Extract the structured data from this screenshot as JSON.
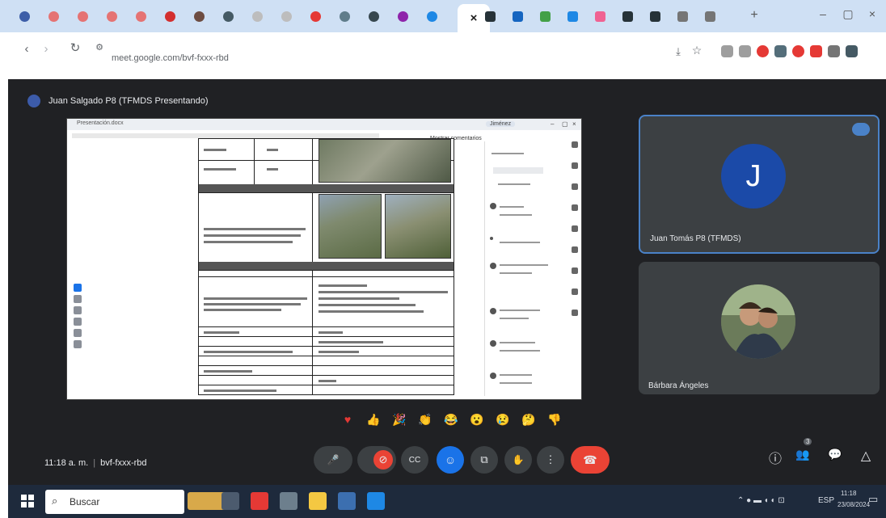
{
  "browser": {
    "url": "meet.google.com/bvf-fxxx-rbd",
    "tab_close_glyph": "×",
    "new_tab_glyph": "+",
    "window_controls": [
      "–",
      "▢",
      "×"
    ],
    "tab_colors": [
      "#3d5ea8",
      "#e57373",
      "#e57373",
      "#e57373",
      "#e57373",
      "#d32f2f",
      "#6d4c41",
      "#455a64",
      "#bdbdbd",
      "#bdbdbd",
      "#e53935",
      "#607d8b",
      "#37474f",
      "#8e24aa",
      "#1e88e5"
    ],
    "tab_colors_right": [
      "#263238",
      "#1565c0",
      "#43a047",
      "#1e88e5",
      "#f06292",
      "#263238",
      "#263238",
      "#757575",
      "#757575"
    ],
    "extension_colors": [
      "#9e9e9e",
      "#9e9e9e",
      "#e53935",
      "#546e7a",
      "#e53935",
      "#e53935",
      "#757575",
      "#455a64"
    ],
    "nav_icons": [
      "back-icon",
      "forward-icon",
      "reload-icon",
      "site-info-icon"
    ]
  },
  "meet": {
    "title": "Juan Salgado P8 (TFMDS Presentando)",
    "presentation": {
      "doc_title": "Presentación.docx",
      "account": "Jiménez",
      "comments_label": "Mostrar comentarios",
      "left_tools": [
        "tool-1",
        "tool-2",
        "tool-3",
        "tool-4",
        "tool-5",
        "tool-6"
      ]
    },
    "participants": [
      {
        "name": "Juan Tomás P8 (TFMDS)",
        "initial": "J",
        "avatar_color": "#1b4aa8",
        "speaking": true
      },
      {
        "name": "Bárbara Ángeles",
        "initial": "",
        "avatar_color": "#5e6b55",
        "speaking": false
      }
    ],
    "reactions": [
      {
        "icon": "heart",
        "glyph": "♥",
        "color": "#e53935"
      },
      {
        "icon": "thumbs-up",
        "glyph": "👍",
        "color": "#f5b400"
      },
      {
        "icon": "party",
        "glyph": "🎉",
        "color": "#f5b400"
      },
      {
        "icon": "clap",
        "glyph": "👏",
        "color": "#f5b400"
      },
      {
        "icon": "laugh",
        "glyph": "😂",
        "color": "#f5b400"
      },
      {
        "icon": "surprised",
        "glyph": "😮",
        "color": "#f5b400"
      },
      {
        "icon": "sad",
        "glyph": "😢",
        "color": "#f5b400"
      },
      {
        "icon": "thinking",
        "glyph": "🤔",
        "color": "#f5b400"
      },
      {
        "icon": "thumbs-down",
        "glyph": "👎",
        "color": "#f5b400"
      }
    ],
    "meeting_time": "11:18 a. m.",
    "meeting_code": "bvf-fxxx-rbd",
    "controls": {
      "mic_glyph": "🎤",
      "camera_glyph": "⊘",
      "captions_glyph": "CC",
      "present_glyph": "⧉",
      "hand_glyph": "✋",
      "more_glyph": "⋮",
      "hangup_glyph": "☎"
    },
    "side_controls": {
      "info_glyph": "ⓘ",
      "people_glyph": "👥",
      "people_count": "3",
      "chat_glyph": "💬",
      "activities_glyph": "△"
    }
  },
  "taskbar": {
    "search_label": "Buscar",
    "search_glyph": "⌕",
    "app_colors": [
      "#d8a94a",
      "#4c5b6e",
      "#e53935",
      "#6d7f8d",
      "#f4c842",
      "#3c6fb0",
      "#1e88e5"
    ],
    "tray_text": "ESP",
    "clock_time": "11:18",
    "clock_date": "23/08/2024"
  }
}
